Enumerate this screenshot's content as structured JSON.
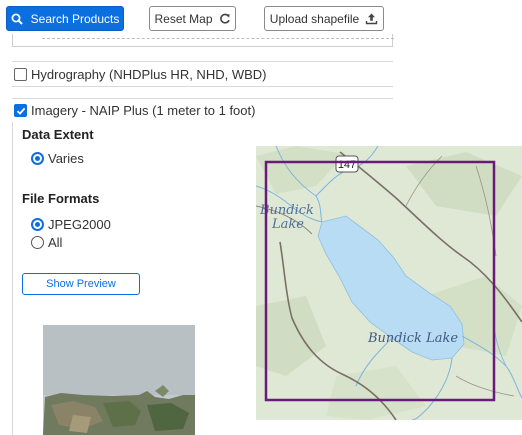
{
  "toolbar": {
    "search_label": "Search Products",
    "reset_label": "Reset Map",
    "upload_label": "Upload shapefile"
  },
  "datasets": {
    "hydrography": {
      "label": "Hydrography (NHDPlus HR, NHD, WBD)",
      "checked": false
    },
    "imagery": {
      "label": "Imagery - NAIP Plus (1 meter to 1 foot)",
      "checked": true
    }
  },
  "filters": {
    "data_extent": {
      "heading": "Data Extent",
      "options": [
        {
          "label": "Varies",
          "selected": true
        }
      ]
    },
    "file_formats": {
      "heading": "File Formats",
      "options": [
        {
          "label": "JPEG2000",
          "selected": true
        },
        {
          "label": "All",
          "selected": false
        }
      ]
    }
  },
  "preview": {
    "button_label": "Show Preview"
  },
  "map": {
    "lake_label": "Bundick Lake",
    "lake_label_top_line1": "Bundick",
    "lake_label_top_line2": "Lake",
    "route_shield": "147",
    "footprint_color": "#6a1b7a",
    "water_color": "#b8dcf3",
    "land_color": "#dfe8d4"
  },
  "icons": {
    "search": "search-icon",
    "reset": "refresh-icon",
    "upload": "upload-icon"
  },
  "colors": {
    "primary": "#0b6fe0",
    "border": "#8a8a8a"
  }
}
